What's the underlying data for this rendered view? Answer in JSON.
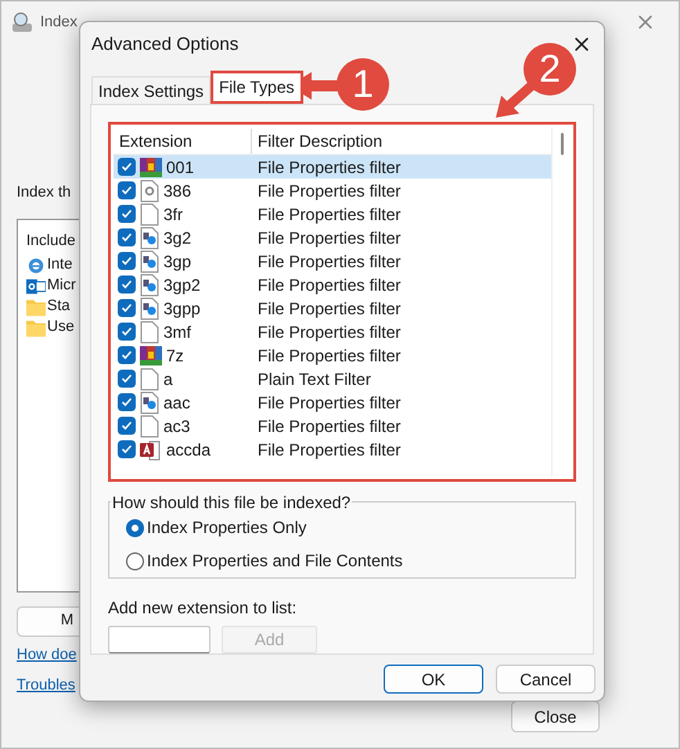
{
  "back_window": {
    "title": "Index",
    "heading": "Index th",
    "included_header": "Include",
    "locations": [
      {
        "kind": "browser",
        "label": "Inte"
      },
      {
        "kind": "mail",
        "label": "Micr"
      },
      {
        "kind": "folder",
        "label": "Sta"
      },
      {
        "kind": "folder",
        "label": "Use"
      }
    ],
    "button": "M",
    "links": [
      "How doe",
      "Troubles"
    ],
    "close_button": "Close"
  },
  "dialog": {
    "title": "Advanced Options",
    "tabs": [
      {
        "label": "Index Settings",
        "selected": false
      },
      {
        "label": "File Types",
        "selected": true
      }
    ],
    "columns": [
      "Extension",
      "Filter Description"
    ],
    "rows": [
      {
        "kind": "archive",
        "extension": "001",
        "filter": "File Properties filter",
        "checked": true,
        "selected": true
      },
      {
        "kind": "system",
        "extension": "386",
        "filter": "File Properties filter",
        "checked": true,
        "selected": false
      },
      {
        "kind": "blank",
        "extension": "3fr",
        "filter": "File Properties filter",
        "checked": true,
        "selected": false
      },
      {
        "kind": "media",
        "extension": "3g2",
        "filter": "File Properties filter",
        "checked": true,
        "selected": false
      },
      {
        "kind": "media",
        "extension": "3gp",
        "filter": "File Properties filter",
        "checked": true,
        "selected": false
      },
      {
        "kind": "media",
        "extension": "3gp2",
        "filter": "File Properties filter",
        "checked": true,
        "selected": false
      },
      {
        "kind": "media",
        "extension": "3gpp",
        "filter": "File Properties filter",
        "checked": true,
        "selected": false
      },
      {
        "kind": "blank",
        "extension": "3mf",
        "filter": "File Properties filter",
        "checked": true,
        "selected": false
      },
      {
        "kind": "archive",
        "extension": "7z",
        "filter": "File Properties filter",
        "checked": true,
        "selected": false
      },
      {
        "kind": "blank",
        "extension": "a",
        "filter": "Plain Text Filter",
        "checked": true,
        "selected": false
      },
      {
        "kind": "media",
        "extension": "aac",
        "filter": "File Properties filter",
        "checked": true,
        "selected": false
      },
      {
        "kind": "blank",
        "extension": "ac3",
        "filter": "File Properties filter",
        "checked": true,
        "selected": false
      },
      {
        "kind": "access",
        "extension": "accda",
        "filter": "File Properties filter",
        "checked": true,
        "selected": false
      }
    ],
    "index_group": {
      "title": "How should this file be indexed?",
      "options": [
        {
          "label": "Index Properties Only",
          "selected": true
        },
        {
          "label": "Index Properties and File Contents",
          "selected": false
        }
      ]
    },
    "add_label": "Add new extension to list:",
    "add_button": {
      "label": "Add",
      "disabled": true
    },
    "buttons": [
      "OK",
      "Cancel"
    ]
  },
  "annotations": [
    {
      "label": "1"
    },
    {
      "label": "2"
    }
  ]
}
